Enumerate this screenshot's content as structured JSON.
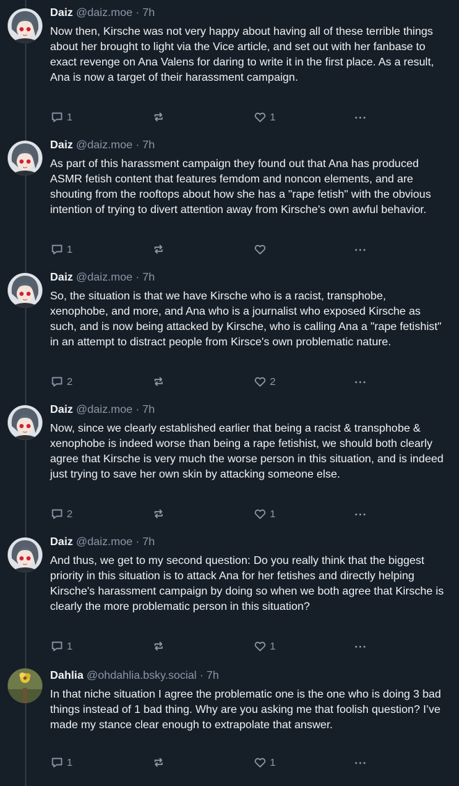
{
  "colors": {
    "background": "#161e27",
    "text": "#f1f3f5",
    "muted": "#8b98a9",
    "thread_line": "#2e3a48"
  },
  "separator": "·",
  "posts": [
    {
      "author": "Daiz",
      "handle": "@daiz.moe",
      "time": "7h",
      "avatar": "anime-avatar",
      "text": "Now then, Kirsche was not very happy about having all of these terrible things about her brought to light via the Vice article, and set out with her fanbase to exact revenge on Ana Valens for daring to write it in the first place. As a result, Ana is now a target of their harassment campaign.",
      "replies": "1",
      "reposts": "",
      "likes": "1"
    },
    {
      "author": "Daiz",
      "handle": "@daiz.moe",
      "time": "7h",
      "avatar": "anime-avatar",
      "text": "As part of this harassment campaign they found out that Ana has produced ASMR fetish content that features femdom and noncon elements, and are shouting from the rooftops about how she has a \"rape fetish\" with the obvious intention of trying to divert attention away from Kirsche's own awful behavior.",
      "replies": "1",
      "reposts": "",
      "likes": ""
    },
    {
      "author": "Daiz",
      "handle": "@daiz.moe",
      "time": "7h",
      "avatar": "anime-avatar",
      "text": "So, the situation is that we have Kirsche who is a racist, transphobe, xenophobe, and more, and Ana who is a journalist who exposed Kirsche as such, and is now being attacked by Kirsche, who is calling Ana a \"rape fetishist\" in an attempt to distract people from Kirsce's own problematic nature.",
      "replies": "2",
      "reposts": "",
      "likes": "2"
    },
    {
      "author": "Daiz",
      "handle": "@daiz.moe",
      "time": "7h",
      "avatar": "anime-avatar",
      "text": "Now, since we clearly established earlier that being a racist & transphobe & xenophobe is indeed worse than being a rape fetishist, we should both clearly agree that Kirsche is very much the worse person in this situation, and is indeed just trying to save her own skin by attacking someone else.",
      "replies": "2",
      "reposts": "",
      "likes": "1"
    },
    {
      "author": "Daiz",
      "handle": "@daiz.moe",
      "time": "7h",
      "avatar": "anime-avatar",
      "text": "And thus, we get to my second question: Do you really think that the biggest priority in this situation is to attack Ana for her fetishes and directly helping Kirsche's harassment campaign by doing so when we both agree that Kirsche is clearly the more problematic person in this situation?",
      "replies": "1",
      "reposts": "",
      "likes": "1"
    },
    {
      "author": "Dahlia",
      "handle": "@ohdahlia.bsky.social",
      "time": "7h",
      "avatar": "flower-avatar",
      "text": "In that niche situation I agree the problematic one is the one who is doing 3 bad things instead of 1 bad thing. Why are you asking me that foolish question? I’ve made my stance clear enough to extrapolate that answer.",
      "replies": "1",
      "reposts": "",
      "likes": "1"
    }
  ]
}
